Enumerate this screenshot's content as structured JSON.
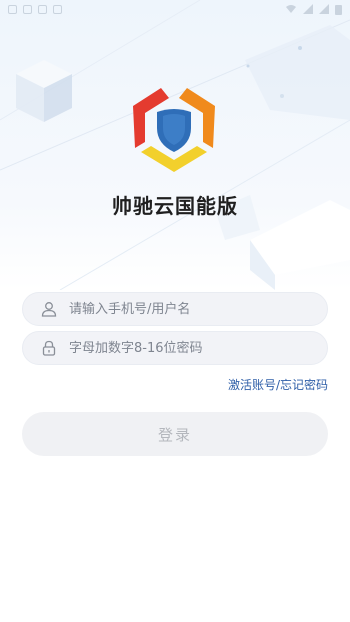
{
  "app": {
    "title": "帅驰云国能版"
  },
  "login": {
    "username_placeholder": "请输入手机号/用户名",
    "password_placeholder": "字母加数字8-16位密码",
    "activate_forgot_link": "激活账号/忘记密码",
    "login_button": "登录"
  },
  "icons": {
    "username": "user-icon",
    "password": "lock-icon"
  },
  "colors": {
    "logo_red": "#e43b2f",
    "logo_orange": "#f08a1c",
    "logo_yellow": "#f2d02c",
    "logo_blue": "#2f6eb8",
    "link": "#2f5fa8",
    "button_bg": "#f0f1f4",
    "button_text": "#b4b7bd"
  }
}
